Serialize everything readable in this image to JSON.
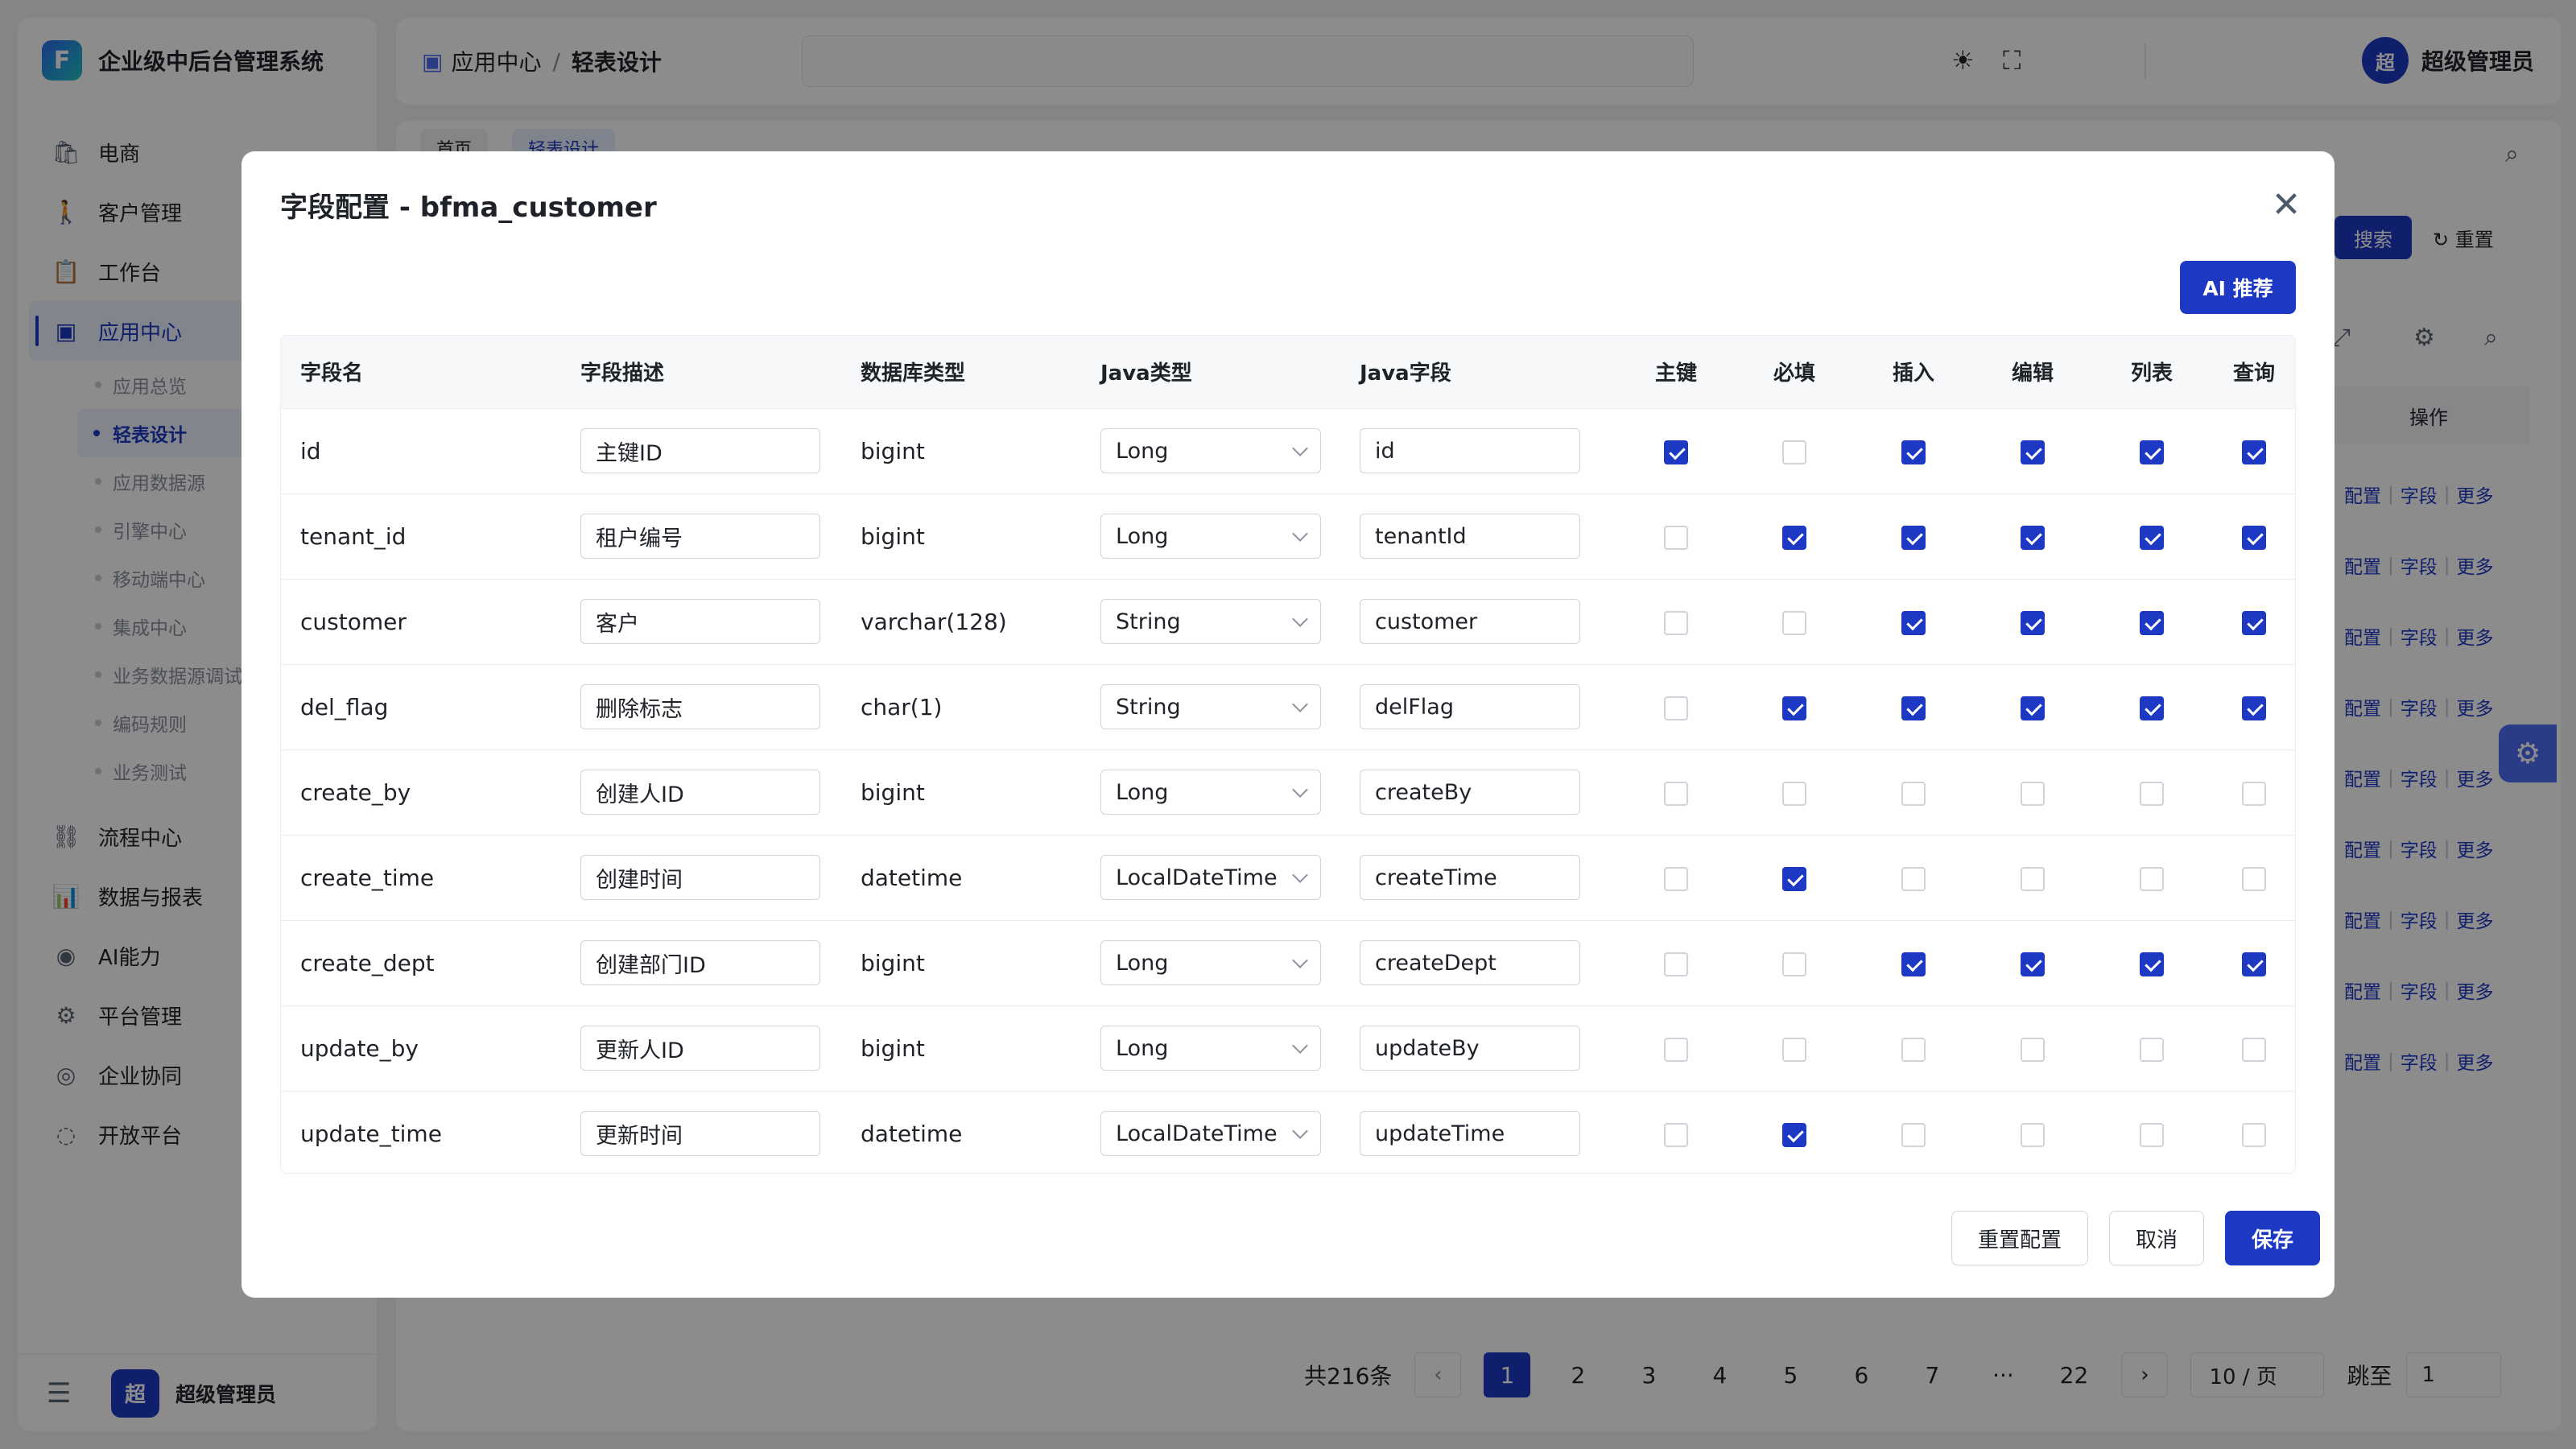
{
  "app": {
    "title": "企业级中后台管理系统",
    "logo_letter": "F"
  },
  "sidebar": {
    "items": [
      {
        "label": "电商",
        "icon": "shopping-bag-icon",
        "glyph": "🛍"
      },
      {
        "label": "客户管理",
        "icon": "person-icon",
        "glyph": "🚶"
      },
      {
        "label": "工作台",
        "icon": "clipboard-icon",
        "glyph": "📋"
      },
      {
        "label": "应用中心",
        "icon": "app-center-icon",
        "glyph": "▣",
        "active": true
      }
    ],
    "submenu": [
      {
        "label": "应用总览"
      },
      {
        "label": "轻表设计",
        "active": true
      },
      {
        "label": "应用数据源"
      },
      {
        "label": "引擎中心"
      },
      {
        "label": "移动端中心"
      },
      {
        "label": "集成中心"
      },
      {
        "label": "业务数据源调试"
      },
      {
        "label": "编码规则"
      },
      {
        "label": "业务测试"
      }
    ],
    "items_after": [
      {
        "label": "流程中心",
        "icon": "flow-icon",
        "glyph": "⛓"
      },
      {
        "label": "数据与报表",
        "icon": "report-icon",
        "glyph": "📊"
      },
      {
        "label": "AI能力",
        "icon": "ai-icon",
        "glyph": "◉"
      },
      {
        "label": "平台管理",
        "icon": "platform-icon",
        "glyph": "⚙"
      },
      {
        "label": "企业协同",
        "icon": "collab-icon",
        "glyph": "◎"
      },
      {
        "label": "开放平台",
        "icon": "open-platform-icon",
        "glyph": "◌"
      }
    ],
    "footer_avatar": "超",
    "footer_user": "超级管理员"
  },
  "header": {
    "breadcrumb": [
      "应用中心",
      "轻表设计"
    ],
    "avatar": "超",
    "user": "超级管理员"
  },
  "content": {
    "tabs": [
      "首页",
      "轻表设计"
    ],
    "search_btn": "搜索",
    "reset_btn": "重置",
    "op_header": "操作",
    "op_links": [
      "配置",
      "字段",
      "更多"
    ],
    "op_rows": 9
  },
  "pagination": {
    "total": "共216条",
    "pages": [
      "1",
      "2",
      "3",
      "4",
      "5",
      "6",
      "7",
      "···",
      "22"
    ],
    "page_size": "10 / 页",
    "jump_label": "跳至",
    "jump_value": "1"
  },
  "modal": {
    "title": "字段配置 - bfma_customer",
    "ai_btn": "AI 推荐",
    "columns": [
      "字段名",
      "字段描述",
      "数据库类型",
      "Java类型",
      "Java字段",
      "主键",
      "必填",
      "插入",
      "编辑",
      "列表",
      "查询"
    ],
    "rows": [
      {
        "name": "id",
        "desc": "主键ID",
        "db_type": "bigint",
        "java_type": "Long",
        "java_field": "id",
        "pk": true,
        "required": false,
        "insert": true,
        "edit": true,
        "list": true,
        "query": true
      },
      {
        "name": "tenant_id",
        "desc": "租户编号",
        "db_type": "bigint",
        "java_type": "Long",
        "java_field": "tenantId",
        "pk": false,
        "required": true,
        "insert": true,
        "edit": true,
        "list": true,
        "query": true
      },
      {
        "name": "customer",
        "desc": "客户",
        "db_type": "varchar(128)",
        "java_type": "String",
        "java_field": "customer",
        "pk": false,
        "required": false,
        "insert": true,
        "edit": true,
        "list": true,
        "query": true
      },
      {
        "name": "del_flag",
        "desc": "删除标志",
        "db_type": "char(1)",
        "java_type": "String",
        "java_field": "delFlag",
        "pk": false,
        "required": true,
        "insert": true,
        "edit": true,
        "list": true,
        "query": true
      },
      {
        "name": "create_by",
        "desc": "创建人ID",
        "db_type": "bigint",
        "java_type": "Long",
        "java_field": "createBy",
        "pk": false,
        "required": false,
        "insert": false,
        "edit": false,
        "list": false,
        "query": false
      },
      {
        "name": "create_time",
        "desc": "创建时间",
        "db_type": "datetime",
        "java_type": "LocalDateTime",
        "java_field": "createTime",
        "pk": false,
        "required": true,
        "insert": false,
        "edit": false,
        "list": false,
        "query": false
      },
      {
        "name": "create_dept",
        "desc": "创建部门ID",
        "db_type": "bigint",
        "java_type": "Long",
        "java_field": "createDept",
        "pk": false,
        "required": false,
        "insert": true,
        "edit": true,
        "list": true,
        "query": true
      },
      {
        "name": "update_by",
        "desc": "更新人ID",
        "db_type": "bigint",
        "java_type": "Long",
        "java_field": "updateBy",
        "pk": false,
        "required": false,
        "insert": false,
        "edit": false,
        "list": false,
        "query": false
      },
      {
        "name": "update_time",
        "desc": "更新时间",
        "db_type": "datetime",
        "java_type": "LocalDateTime",
        "java_field": "updateTime",
        "pk": false,
        "required": true,
        "insert": false,
        "edit": false,
        "list": false,
        "query": false
      }
    ],
    "footer": {
      "reset": "重置配置",
      "cancel": "取消",
      "save": "保存"
    }
  },
  "colors": {
    "primary": "#1d39c4",
    "overlay": "rgba(0,0,0,0.45)"
  }
}
